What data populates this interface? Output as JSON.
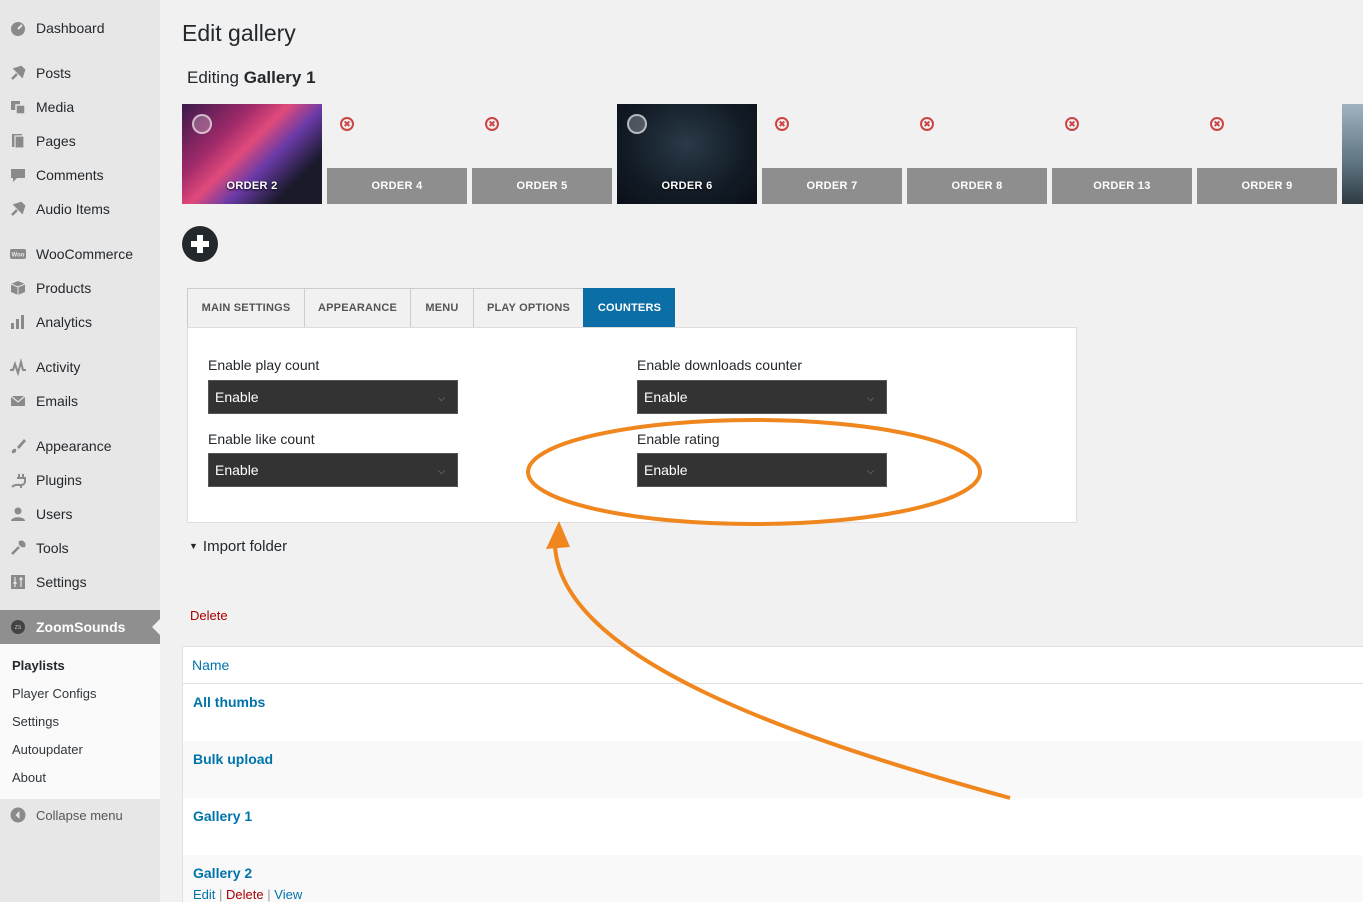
{
  "sidebar": {
    "items": [
      {
        "label": "Dashboard",
        "icon": "dashboard-icon"
      },
      {
        "label": "Posts",
        "icon": "pin-icon"
      },
      {
        "label": "Media",
        "icon": "media-icon"
      },
      {
        "label": "Pages",
        "icon": "pages-icon"
      },
      {
        "label": "Comments",
        "icon": "comment-icon"
      },
      {
        "label": "Audio Items",
        "icon": "pin-icon"
      },
      {
        "label": "WooCommerce",
        "icon": "woocommerce-icon"
      },
      {
        "label": "Products",
        "icon": "box-icon"
      },
      {
        "label": "Analytics",
        "icon": "bar-chart-icon"
      },
      {
        "label": "Activity",
        "icon": "activity-icon"
      },
      {
        "label": "Emails",
        "icon": "envelope-icon"
      },
      {
        "label": "Appearance",
        "icon": "brush-icon"
      },
      {
        "label": "Plugins",
        "icon": "plug-icon"
      },
      {
        "label": "Users",
        "icon": "user-icon"
      },
      {
        "label": "Tools",
        "icon": "wrench-icon"
      },
      {
        "label": "Settings",
        "icon": "sliders-icon"
      },
      {
        "label": "ZoomSounds",
        "icon": "zoomsounds-icon"
      }
    ],
    "submenu": [
      "Playlists",
      "Player Configs",
      "Settings",
      "Autoupdater",
      "About"
    ],
    "collapse_label": "Collapse menu"
  },
  "page": {
    "title": "Edit gallery",
    "editing_prefix": "Editing",
    "gallery_name": "Gallery 1"
  },
  "thumbnails": [
    "ORDER 2",
    "ORDER 4",
    "ORDER 5",
    "ORDER 6",
    "ORDER 7",
    "ORDER 8",
    "ORDER 13",
    "ORDER 9"
  ],
  "tabs": [
    "MAIN SETTINGS",
    "APPEARANCE",
    "MENU",
    "PLAY OPTIONS",
    "COUNTERS"
  ],
  "active_tab": "COUNTERS",
  "counters": {
    "play_count_label": "Enable play count",
    "play_count_value": "Enable",
    "downloads_label": "Enable downloads counter",
    "downloads_value": "Enable",
    "like_count_label": "Enable like count",
    "like_count_value": "Enable",
    "rating_label": "Enable rating",
    "rating_value": "Enable"
  },
  "import_folder_label": "Import folder",
  "delete_label": "Delete",
  "table": {
    "column_name": "Name",
    "rows": [
      "All thumbs",
      "Bulk upload",
      "Gallery 1",
      "Gallery 2"
    ],
    "row_actions": {
      "edit": "Edit",
      "delete": "Delete",
      "view": "View",
      "separator": "|"
    }
  },
  "colors": {
    "accent": "#0c6ea6",
    "annotation": "#f0861e",
    "link": "#0073aa",
    "danger": "#aa0000"
  }
}
